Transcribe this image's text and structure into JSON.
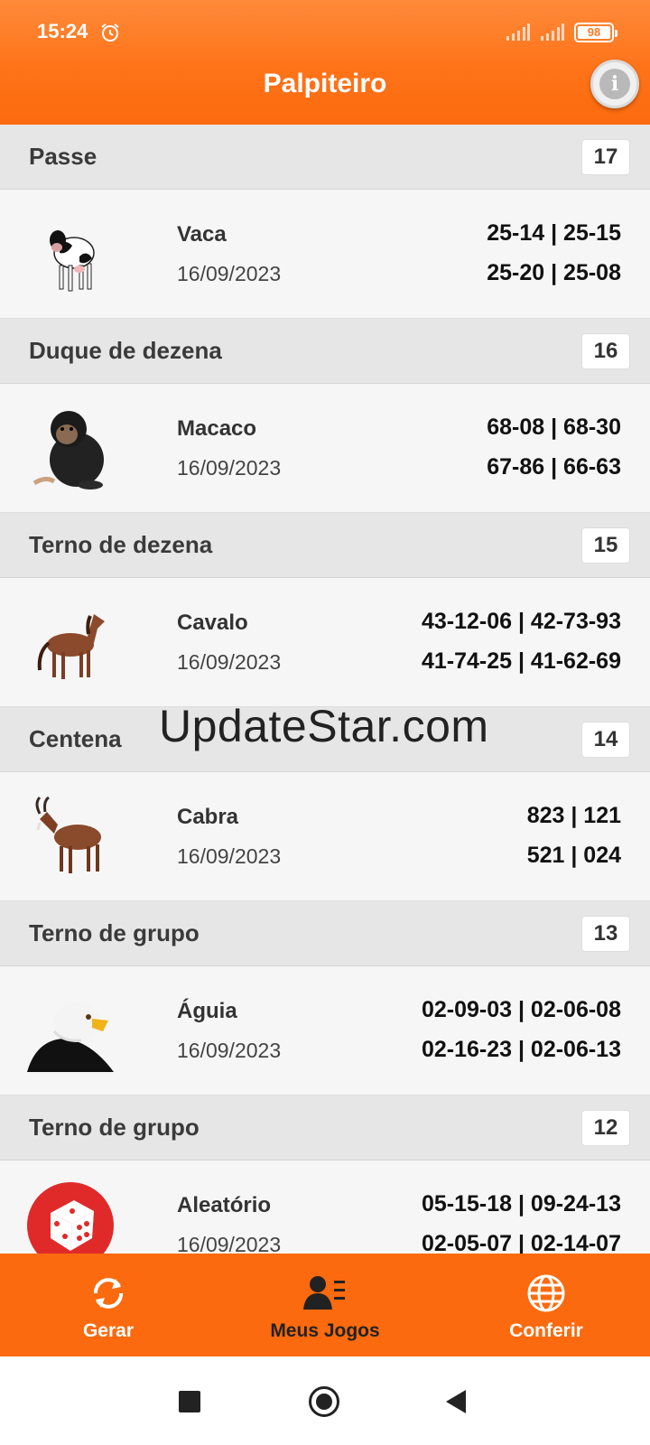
{
  "status_bar": {
    "time": "15:24",
    "battery": "98"
  },
  "app": {
    "title": "Palpiteiro"
  },
  "games": [
    {
      "category": "Passe",
      "count": "17",
      "animal": "Vaca",
      "date": "16/09/2023",
      "line1": "25-14 | 25-15",
      "line2": "25-20 | 25-08",
      "icon": "cow-icon"
    },
    {
      "category": "Duque de dezena",
      "count": "16",
      "animal": "Macaco",
      "date": "16/09/2023",
      "line1": "68-08 | 68-30",
      "line2": "67-86 | 66-63",
      "icon": "monkey-icon"
    },
    {
      "category": "Terno de dezena",
      "count": "15",
      "animal": "Cavalo",
      "date": "16/09/2023",
      "line1": "43-12-06 | 42-73-93",
      "line2": "41-74-25 | 41-62-69",
      "icon": "horse-icon"
    },
    {
      "category": "Centena",
      "count": "14",
      "animal": "Cabra",
      "date": "16/09/2023",
      "line1": "823 | 121",
      "line2": "521 | 024",
      "icon": "goat-icon"
    },
    {
      "category": "Terno de grupo",
      "count": "13",
      "animal": "Águia",
      "date": "16/09/2023",
      "line1": "02-09-03 | 02-06-08",
      "line2": "02-16-23 | 02-06-13",
      "icon": "eagle-icon"
    },
    {
      "category": "Terno de grupo",
      "count": "12",
      "animal": "Aleatório",
      "date": "16/09/2023",
      "line1": "05-15-18 | 09-24-13",
      "line2": "02-05-07 | 02-14-07",
      "icon": "dice-icon"
    }
  ],
  "watermark": "UpdateStar.com",
  "bottom_nav": {
    "gerar": "Gerar",
    "meus_jogos": "Meus Jogos",
    "conferir": "Conferir"
  },
  "colors": {
    "primary": "#fb6a0e",
    "section_bg": "#e6e6e6",
    "row_bg": "#f6f6f6",
    "dice_red": "#e02a2a"
  }
}
